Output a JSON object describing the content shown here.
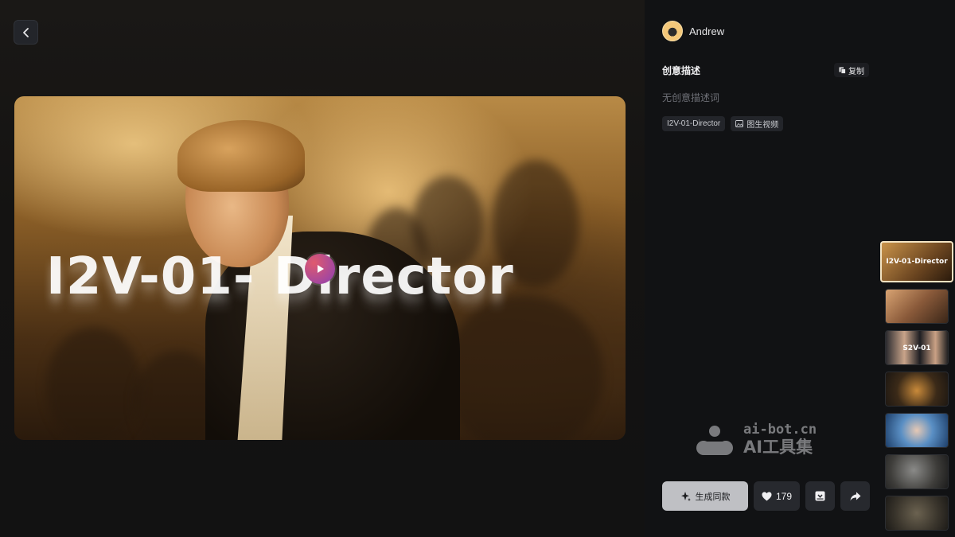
{
  "author": {
    "name": "Andrew"
  },
  "creative": {
    "title": "创意描述",
    "copy_label": "复制",
    "description": "无创意描述词"
  },
  "tags": [
    {
      "label": "I2V-01-Director"
    },
    {
      "label": "图生视频",
      "icon": "image-icon"
    }
  ],
  "video": {
    "overlay_text": "I2V-01-        Director"
  },
  "thumbnails": [
    {
      "label": "I2V-01-Director",
      "active": true
    },
    {
      "label": ""
    },
    {
      "label": "S2V-01"
    },
    {
      "label": ""
    },
    {
      "label": ""
    },
    {
      "label": ""
    },
    {
      "label": ""
    }
  ],
  "watermark": {
    "top": "ai-bot.cn",
    "bottom": "AI工具集"
  },
  "actions": {
    "generate_label": "生成同款",
    "like_count": "179"
  },
  "colors": {
    "background": "#111214",
    "panel_button": "#27292e",
    "primary_button": "#bfc0c4",
    "play_gradient_start": "#e05a6e",
    "play_gradient_end": "#8b3fb3"
  }
}
